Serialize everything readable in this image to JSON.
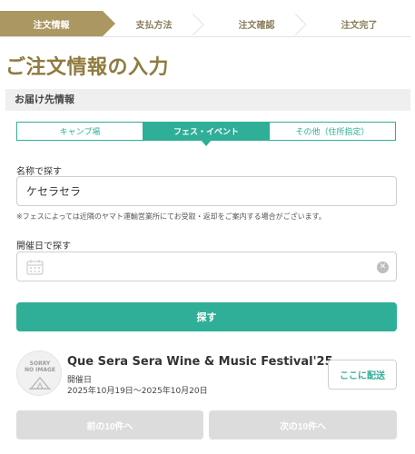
{
  "stepper": {
    "steps": [
      {
        "label": "注文情報",
        "active": true
      },
      {
        "label": "支払方法",
        "active": false
      },
      {
        "label": "注文確認",
        "active": false
      },
      {
        "label": "注文完了",
        "active": false
      }
    ]
  },
  "page": {
    "title": "ご注文情報の入力",
    "section_header": "お届け先情報"
  },
  "delivery_tabs": [
    {
      "label": "キャンプ場",
      "active": false
    },
    {
      "label": "フェス・イベント",
      "active": true
    },
    {
      "label": "その他（住所指定）",
      "active": false
    }
  ],
  "search_by_name": {
    "label": "名称で探す",
    "value": "ケセラセラ"
  },
  "note": "※フェスによっては近隣のヤマト運輸営業所にてお受取・返却をご案内する場合がございます。",
  "search_by_date": {
    "label": "開催日で探す",
    "value": "",
    "clear_glyph": "✕"
  },
  "search_button_label": "探す",
  "result": {
    "thumbnail_text_1": "SORRY",
    "thumbnail_text_2": "NO IMAGE",
    "name": "Que Sera Sera Wine & Music Festival'25",
    "date_label": "開催日",
    "dates": "2025年10月19日〜2025年10月20日",
    "deliver_button_label": "ここに配送"
  },
  "pager": {
    "prev_label": "前の10件へ",
    "next_label": "次の10件へ"
  },
  "colors": {
    "accent_gold": "#ab9762",
    "title_gold": "#8f7b3e",
    "accent_teal": "#2fae98",
    "disabled_gray": "#dcdcdc"
  },
  "icons": {
    "calendar": "calendar-icon",
    "clear": "clear-icon",
    "chevron": "chevron-right-icon",
    "tent": "tent-icon"
  }
}
